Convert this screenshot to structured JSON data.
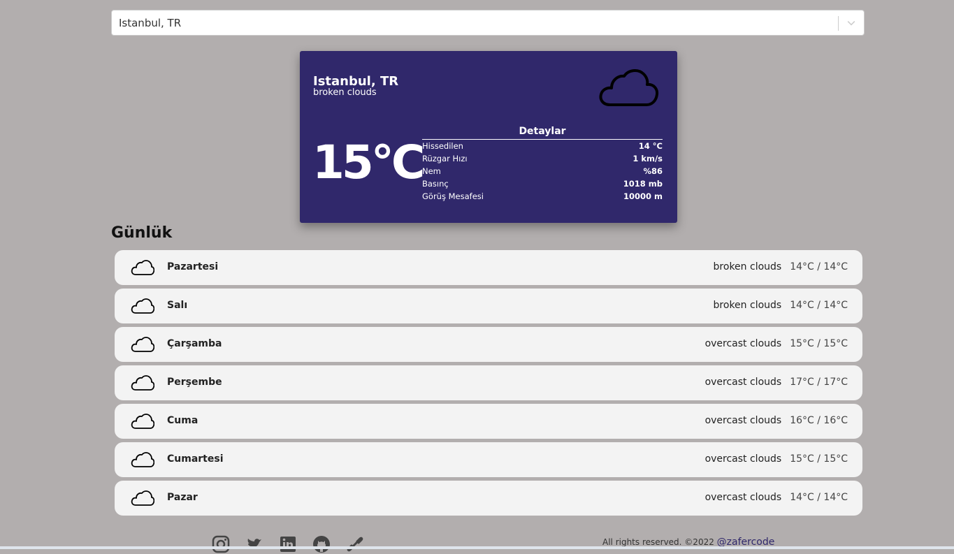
{
  "search": {
    "value": "Istanbul, TR"
  },
  "current": {
    "city": "Istanbul, TR",
    "description": "broken clouds",
    "temperature": "15°C",
    "icon": "cloud-icon",
    "details_title": "Detaylar",
    "details": [
      {
        "label": "Hissedilen",
        "value": "14 °C"
      },
      {
        "label": "Rüzgar Hızı",
        "value": "1 km/s"
      },
      {
        "label": "Nem",
        "value": "%86"
      },
      {
        "label": "Basınç",
        "value": "1018 mb"
      },
      {
        "label": "Görüş Mesafesi",
        "value": "10000 m"
      }
    ]
  },
  "daily": {
    "title": "Günlük",
    "days": [
      {
        "name": "Pazartesi",
        "description": "broken clouds",
        "temps": "14°C / 14°C"
      },
      {
        "name": "Salı",
        "description": "broken clouds",
        "temps": "14°C / 14°C"
      },
      {
        "name": "Çarşamba",
        "description": "overcast clouds",
        "temps": "15°C / 15°C"
      },
      {
        "name": "Perşembe",
        "description": "overcast clouds",
        "temps": "17°C / 17°C"
      },
      {
        "name": "Cuma",
        "description": "overcast clouds",
        "temps": "16°C / 16°C"
      },
      {
        "name": "Cumartesi",
        "description": "overcast clouds",
        "temps": "15°C / 15°C"
      },
      {
        "name": "Pazar",
        "description": "overcast clouds",
        "temps": "14°C / 14°C"
      }
    ]
  },
  "footer": {
    "icons": [
      "instagram-icon",
      "twitter-icon",
      "linkedin-icon",
      "github-icon",
      "link-icon"
    ],
    "copyright": "All rights reserved. ©2022",
    "author": "@zafercode"
  },
  "colors": {
    "background": "#b2aeae",
    "card": "#30286b",
    "row": "#f3f3f3"
  }
}
